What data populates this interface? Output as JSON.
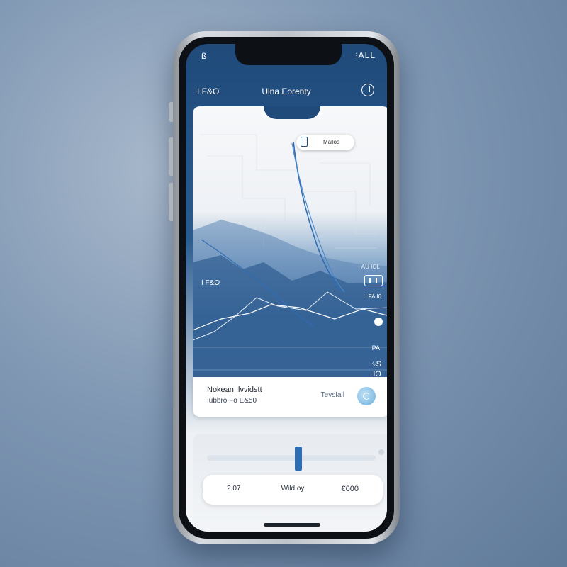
{
  "status": {
    "left": "ß",
    "right": "፧ALL"
  },
  "topbar": {
    "left": "I F&O",
    "title": "Ulna Eorenty"
  },
  "map": {
    "popup_label": "Mallos",
    "left_label": "I F&O",
    "right_label": "AU IOL",
    "right_label2": "I FA I6",
    "scale_top": "PA",
    "scale_mid": "ᛃS",
    "scale_bottom": "IO"
  },
  "info": {
    "title": "Nokean Ilvvidstt",
    "subtitle": "Iubbro Fo E&50",
    "action": "Tevsfall"
  },
  "bottom": {
    "left": "2.07",
    "center": "Wild oy",
    "right": "€600"
  },
  "colors": {
    "accent": "#2e6db4",
    "header": "#1f4a7a"
  }
}
